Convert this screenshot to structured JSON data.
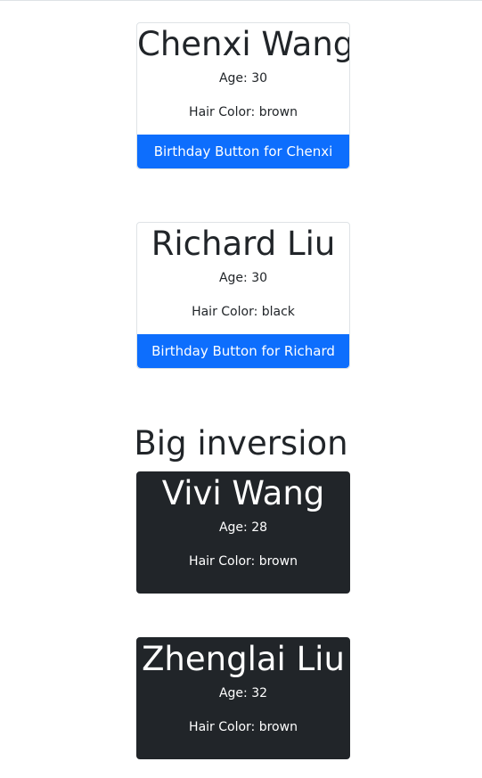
{
  "cards_top": [
    {
      "name": "Chenxi Wang",
      "age": "Age: 30",
      "hair": "Hair Color: brown",
      "button": "Birthday Button for Chenxi"
    },
    {
      "name": "Richard Liu",
      "age": "Age: 30",
      "hair": "Hair Color: black",
      "button": "Birthday Button for Richard"
    }
  ],
  "section": {
    "heading": "Big inversion"
  },
  "cards_dark": [
    {
      "name": "Vivi Wang",
      "age": "Age: 28",
      "hair": "Hair Color: brown"
    },
    {
      "name": "Zhenglai Liu",
      "age": "Age: 32",
      "hair": "Hair Color: brown"
    }
  ],
  "colors": {
    "primary": "#0d6efd",
    "dark": "#212529",
    "text": "#212529",
    "border": "#dfe3e6"
  }
}
